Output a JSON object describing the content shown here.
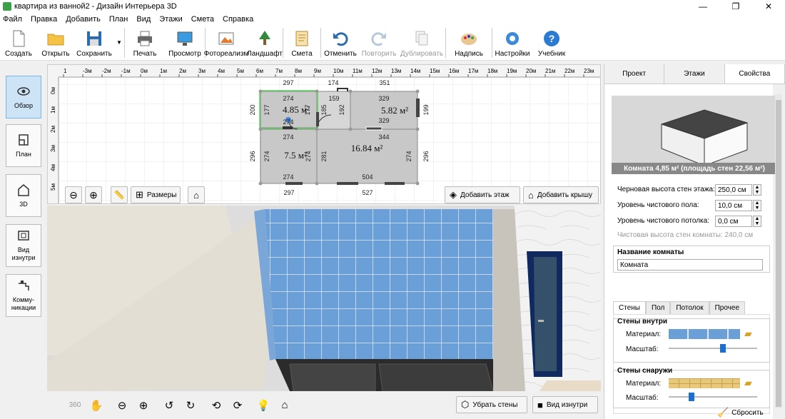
{
  "window": {
    "title": "квартира из ванной2 - Дизайн Интерьера 3D",
    "minimize": "—",
    "maximize": "❐",
    "close": "✕"
  },
  "menu": [
    "Файл",
    "Правка",
    "Добавить",
    "План",
    "Вид",
    "Этажи",
    "Смета",
    "Справка"
  ],
  "toolbar": {
    "create": "Создать",
    "open": "Открыть",
    "save": "Сохранить",
    "print": "Печать",
    "preview": "Просмотр",
    "photoreal": "Фотореализм",
    "landscape": "Ландшафт",
    "estimate": "Смета",
    "undo": "Отменить",
    "redo": "Повторить",
    "duplicate": "Дублировать",
    "label": "Надпись",
    "settings": "Настройки",
    "tutorial": "Учебник"
  },
  "sidebar": {
    "overview": "Обзор",
    "plan": "План",
    "three_d": "3D",
    "inside_view": "Вид изнутри",
    "utilities": "Комму-никации"
  },
  "ruler": {
    "x_labels": [
      "1",
      "-3м",
      "-2м",
      "-1м",
      "0м",
      "1м",
      "2м",
      "3м",
      "4м",
      "5м",
      "6м",
      "7м",
      "8м",
      "9м",
      "10м",
      "11м",
      "12м",
      "13м",
      "14м",
      "15м",
      "16м",
      "17м",
      "18м",
      "19м",
      "20м",
      "21м",
      "22м",
      "23м"
    ],
    "y_labels": [
      "0м",
      "1м",
      "2м",
      "3м",
      "4м",
      "5м"
    ]
  },
  "floorplan": {
    "dims_top": [
      "297",
      "174",
      "351"
    ],
    "room1": {
      "area": "4.85 м²",
      "w": "274",
      "h": "177",
      "h2": "177"
    },
    "room2": {
      "area": "5.82 м²",
      "w": "329",
      "w2": "329",
      "h": "192"
    },
    "room3": {
      "area": "7.5 м²",
      "w": "274",
      "w2": "274",
      "h": "274",
      "h2": "274"
    },
    "room4": {
      "area": "16.84 м²",
      "w": "344",
      "h": "281",
      "h2": "274"
    },
    "door": "159",
    "door_h": "185",
    "left_dims": [
      "200",
      "296"
    ],
    "right_dims": [
      "199",
      "296"
    ],
    "bottom_dims": [
      "297",
      "527",
      "504"
    ],
    "inner": "274"
  },
  "plan_controls": {
    "sizes": "Размеры",
    "add_floor": "Добавить этаж",
    "add_roof": "Добавить крышу"
  },
  "view3d_controls": {
    "remove_walls": "Убрать стены",
    "inside_view": "Вид изнутри"
  },
  "right_panel": {
    "tabs": [
      "Проект",
      "Этажи",
      "Свойства"
    ],
    "caption": "Комната 4,85 м²  (площадь стен 22,56 м²)",
    "props": [
      {
        "label": "Черновая высота стен этажа:",
        "value": "250,0 см"
      },
      {
        "label": "Уровень чистового пола:",
        "value": "10,0 см"
      },
      {
        "label": "Уровень чистового потолка:",
        "value": "0,0 см"
      }
    ],
    "clean_height": "Чистовая высота стен комнаты: 240,0 см",
    "room_name_title": "Название комнаты",
    "room_name_value": "Комната",
    "subtabs": [
      "Стены",
      "Пол",
      "Потолок",
      "Прочее"
    ],
    "walls_inside": "Стены внутри",
    "walls_outside": "Стены снаружи",
    "material": "Материал:",
    "scale": "Масштаб:",
    "reset": "Сбросить",
    "scale_inside": 0.62,
    "scale_outside": 0.24
  },
  "colors": {
    "accent": "#1a6fd0",
    "tile": "#6a9fd8",
    "brick": "#e8c87a"
  }
}
